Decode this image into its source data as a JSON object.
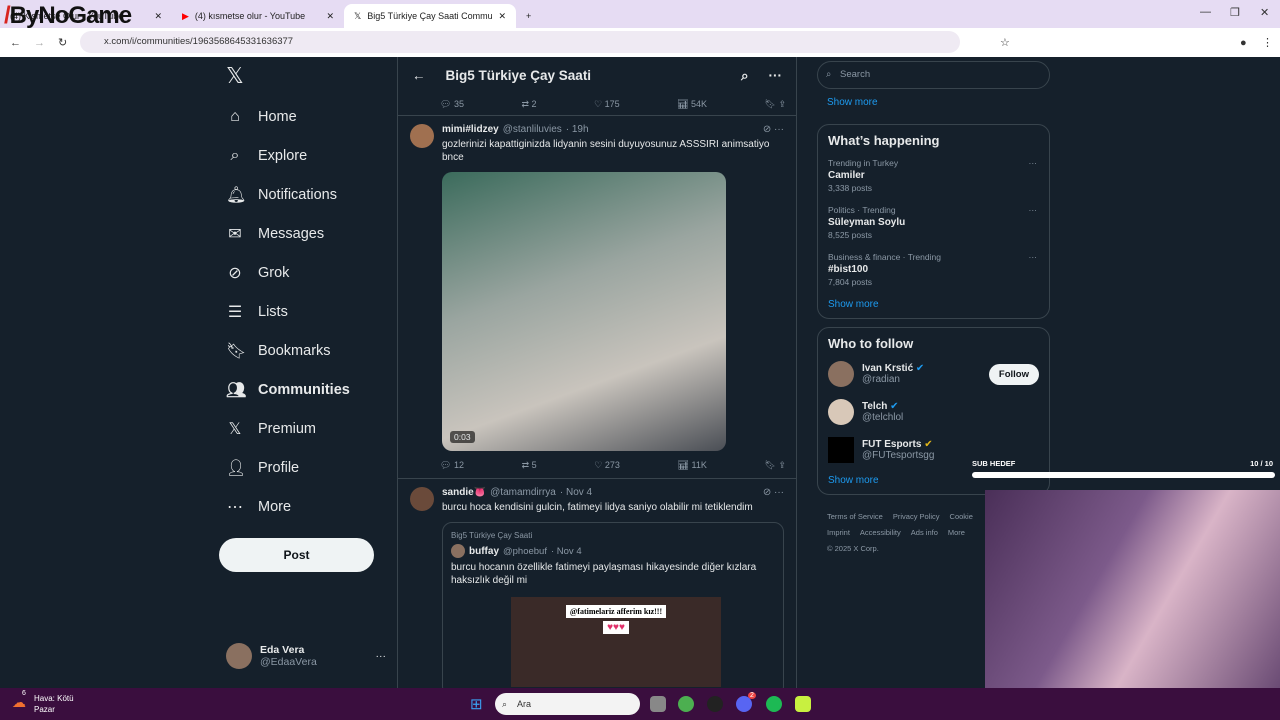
{
  "browser": {
    "tabs": [
      {
        "title": "(4) Kismetse Olur - YouTube"
      },
      {
        "title": "(4) kısmetse olur - YouTube"
      },
      {
        "title": "Big5 Türkiye Çay Saati Commun"
      }
    ],
    "url": "x.com/i/communities/1963568645331636377",
    "overlay_logo": "ByNoGame"
  },
  "nav": {
    "items": [
      {
        "label": "Home",
        "icon": "home-icon"
      },
      {
        "label": "Explore",
        "icon": "search-icon"
      },
      {
        "label": "Notifications",
        "icon": "bell-icon"
      },
      {
        "label": "Messages",
        "icon": "mail-icon"
      },
      {
        "label": "Grok",
        "icon": "grok-icon"
      },
      {
        "label": "Lists",
        "icon": "list-icon"
      },
      {
        "label": "Bookmarks",
        "icon": "bookmark-icon"
      },
      {
        "label": "Communities",
        "icon": "communities-icon"
      },
      {
        "label": "Premium",
        "icon": "x-icon"
      },
      {
        "label": "Profile",
        "icon": "person-icon"
      },
      {
        "label": "More",
        "icon": "more-icon"
      }
    ],
    "post": "Post",
    "user": {
      "name": "Eda Vera",
      "handle": "@EdaaVera"
    }
  },
  "main": {
    "title": "Big5 Türkiye Çay Saati",
    "prev_actions": {
      "replies": "35",
      "reposts": "2",
      "likes": "175",
      "views": "54K"
    },
    "tweets": [
      {
        "name": "mimi#lidzey",
        "handle": "@stanliluvies",
        "time": "· 19h",
        "text": "gozlerinizi kapattiginizda lidyanin sesini duyuyosunuz ASSSIRI animsatiyo bnce",
        "video_duration": "0:03",
        "replies": "12",
        "reposts": "5",
        "likes": "273",
        "views": "11K"
      },
      {
        "name": "sandie👅",
        "handle": "@tamamdirrya",
        "time": "· Nov 4",
        "text": "burcu hoca kendisini gulcin, fatimeyi lidya saniyo olabilir mi tetiklendim",
        "quote": {
          "community": "Big5 Türkiye Çay Saati",
          "name": "buffay",
          "handle": "@phoebuf",
          "time": "· Nov 4",
          "text": "burcu hocanın özellikle fatimeyi paylaşması hikayesinde diğer kızlara haksızlık değil mi",
          "image_caption": "@fatimelariz afferim kız!!!",
          "image_hearts": "♥♥♥"
        }
      }
    ]
  },
  "right": {
    "search_placeholder": "Search",
    "show_more": "Show more",
    "happening": {
      "title": "What’s happening",
      "trends": [
        {
          "context": "Trending in Turkey",
          "name": "Camiler",
          "posts": "3,338 posts"
        },
        {
          "context": "Politics · Trending",
          "name": "Süleyman Soylu",
          "posts": "8,525 posts"
        },
        {
          "context": "Business & finance · Trending",
          "name": "#bist100",
          "posts": "7,804 posts"
        }
      ],
      "show_more": "Show more"
    },
    "who": {
      "title": "Who to follow",
      "users": [
        {
          "name": "Ivan Krstić",
          "handle": "@radian",
          "follow": "Follow"
        },
        {
          "name": "Telch",
          "handle": "@telchlol"
        },
        {
          "name": "FUT Esports",
          "handle": "@FUTesportsgg"
        }
      ],
      "show_more": "Show more"
    },
    "footer": {
      "links": [
        "Terms of Service",
        "Privacy Policy",
        "Cookie",
        "Imprint",
        "Accessibility",
        "Ads info",
        "More"
      ],
      "copyright": "© 2025 X Corp."
    }
  },
  "overlay": {
    "goal_label": "SUB HEDEF",
    "goal_count": "10 / 10",
    "goal_progress": 1.0
  },
  "taskbar": {
    "weather": "Hava: Kötü",
    "day": "Pazar",
    "weather_badge": "6",
    "search": "Ara",
    "discord_badge": "2"
  }
}
